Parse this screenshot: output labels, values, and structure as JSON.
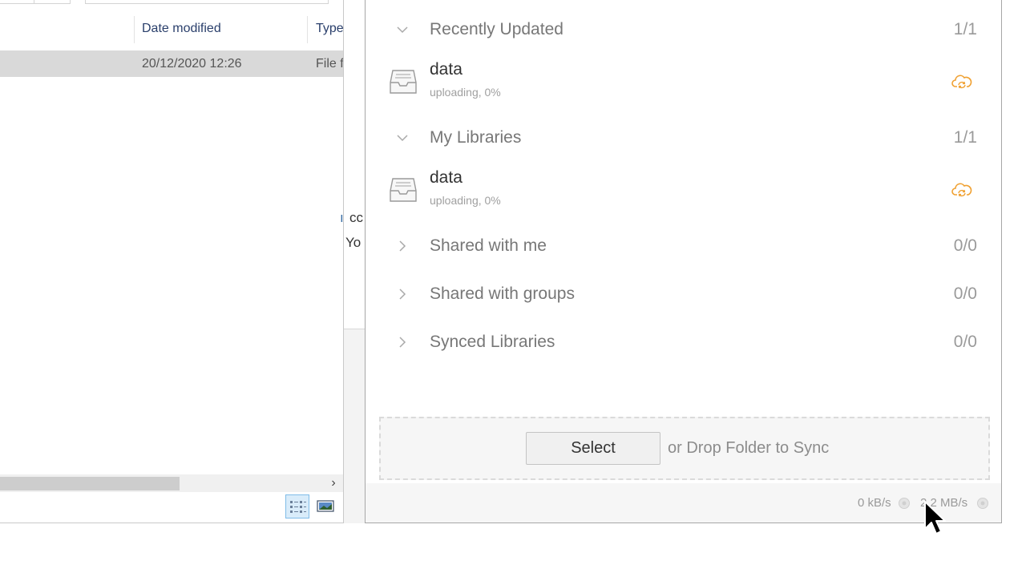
{
  "explorer": {
    "columns": {
      "date_modified": "Date modified",
      "type": "Type"
    },
    "file_row": {
      "date": "20/12/2020 12:26",
      "type": "File f"
    },
    "scroll_arrow": "›"
  },
  "peek_text": {
    "line1": "cc",
    "line1_prefix": "ı",
    "line2": "Yo"
  },
  "seafile": {
    "sections": [
      {
        "title": "Recently Updated",
        "count": "1/1",
        "expanded": true
      },
      {
        "title": "My Libraries",
        "count": "1/1",
        "expanded": true
      },
      {
        "title": "Shared with me",
        "count": "0/0",
        "expanded": false
      },
      {
        "title": "Shared with groups",
        "count": "0/0",
        "expanded": false
      },
      {
        "title": "Synced Libraries",
        "count": "0/0",
        "expanded": false
      }
    ],
    "repos": [
      {
        "name": "data",
        "status": "uploading, 0%"
      },
      {
        "name": "data",
        "status": "uploading, 0%"
      }
    ],
    "drop": {
      "select_label": "Select",
      "hint": "or Drop Folder to Sync"
    },
    "rates": {
      "download": "0 kB/s",
      "upload": "2.2 MB/s"
    }
  },
  "icons": {
    "chevron_down": "chevron-down-icon",
    "chevron_right": "chevron-right-icon",
    "library": "library-icon",
    "cloud_sync": "cloud-sync-icon",
    "rate": "rate-icon",
    "cursor": "mouse-pointer-icon"
  },
  "colors": {
    "cloud_sync": "#f0a030",
    "selection": "#d9d9d9",
    "dropzone_border": "#dadada"
  }
}
